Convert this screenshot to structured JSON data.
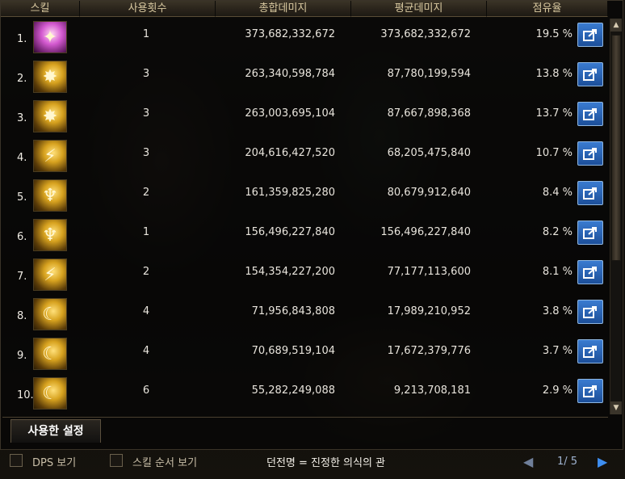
{
  "headers": {
    "skill": "스킬",
    "uses": "사용횟수",
    "total_damage": "총합데미지",
    "avg_damage": "평균데미지",
    "share": "점유율"
  },
  "rows": [
    {
      "rank": "1.",
      "uses": "1",
      "total": "373,682,332,672",
      "avg": "373,682,332,672",
      "share": "19.5 %",
      "icon": "pink-slash-skill-icon"
    },
    {
      "rank": "2.",
      "uses": "3",
      "total": "263,340,598,784",
      "avg": "87,780,199,594",
      "share": "13.8 %",
      "icon": "gold-burst-skill-icon"
    },
    {
      "rank": "3.",
      "uses": "3",
      "total": "263,003,695,104",
      "avg": "87,667,898,368",
      "share": "13.7 %",
      "icon": "gold-burst-skill-icon"
    },
    {
      "rank": "4.",
      "uses": "3",
      "total": "204,616,427,520",
      "avg": "68,205,475,840",
      "share": "10.7 %",
      "icon": "gold-slash-skill-icon"
    },
    {
      "rank": "5.",
      "uses": "2",
      "total": "161,359,825,280",
      "avg": "80,679,912,640",
      "share": "8.4 %",
      "icon": "gold-dragon-skill-icon"
    },
    {
      "rank": "6.",
      "uses": "1",
      "total": "156,496,227,840",
      "avg": "156,496,227,840",
      "share": "8.2 %",
      "icon": "gold-dragon-skill-icon"
    },
    {
      "rank": "7.",
      "uses": "2",
      "total": "154,354,227,200",
      "avg": "77,177,113,600",
      "share": "8.1 %",
      "icon": "gold-slash-skill-icon"
    },
    {
      "rank": "8.",
      "uses": "4",
      "total": "71,956,843,808",
      "avg": "17,989,210,952",
      "share": "3.8 %",
      "icon": "gold-claw-skill-icon"
    },
    {
      "rank": "9.",
      "uses": "4",
      "total": "70,689,519,104",
      "avg": "17,672,379,776",
      "share": "3.7 %",
      "icon": "gold-claw-skill-icon"
    },
    {
      "rank": "10.",
      "uses": "6",
      "total": "55,282,249,088",
      "avg": "9,213,708,181",
      "share": "2.9 %",
      "icon": "gold-claw-skill-icon"
    }
  ],
  "tabs": {
    "used_settings": "사용한 설정"
  },
  "bottom": {
    "dps_view": "DPS 보기",
    "skill_order_view": "스킬 순서 보기",
    "dungeon_name": "던전명 = 진정한 의식의 관",
    "page": "1/ 5"
  },
  "colors": {
    "header_text": "#d9c9a0",
    "share_button": "#2f6fc2",
    "next_arrow": "#3e8ef0"
  }
}
